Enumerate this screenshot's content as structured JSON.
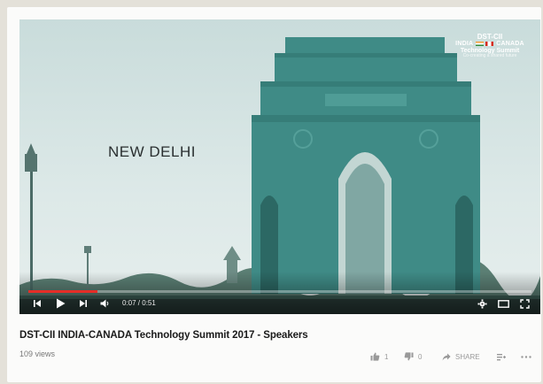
{
  "player": {
    "caption": "NEW DELHI",
    "brand": {
      "line1": "DST-CII",
      "line2_left": "INDIA",
      "line2_right": "CANADA",
      "line3": "Technology Summit",
      "line4": "Co-creating a shared future"
    },
    "time": "0:07 / 0:51",
    "progress": 0.137
  },
  "video": {
    "title": "DST-CII INDIA-CANADA Technology Summit 2017 - Speakers",
    "views": "109 views",
    "likes": "1",
    "dislikes": "0",
    "share_label": "SHARE"
  },
  "icons": {
    "prev": "skip-previous-icon",
    "play": "play-icon",
    "next": "skip-next-icon",
    "volume": "volume-icon",
    "settings": "gear-icon",
    "theater": "theater-mode-icon",
    "fullscreen": "fullscreen-icon",
    "like": "thumbs-up-icon",
    "dislike": "thumbs-down-icon",
    "share": "share-arrow-icon",
    "add": "add-to-playlist-icon",
    "more": "more-icon"
  },
  "colors": {
    "progress": "#e52d27",
    "monument": "#3d8a86",
    "sky": "#d3e3e2"
  }
}
